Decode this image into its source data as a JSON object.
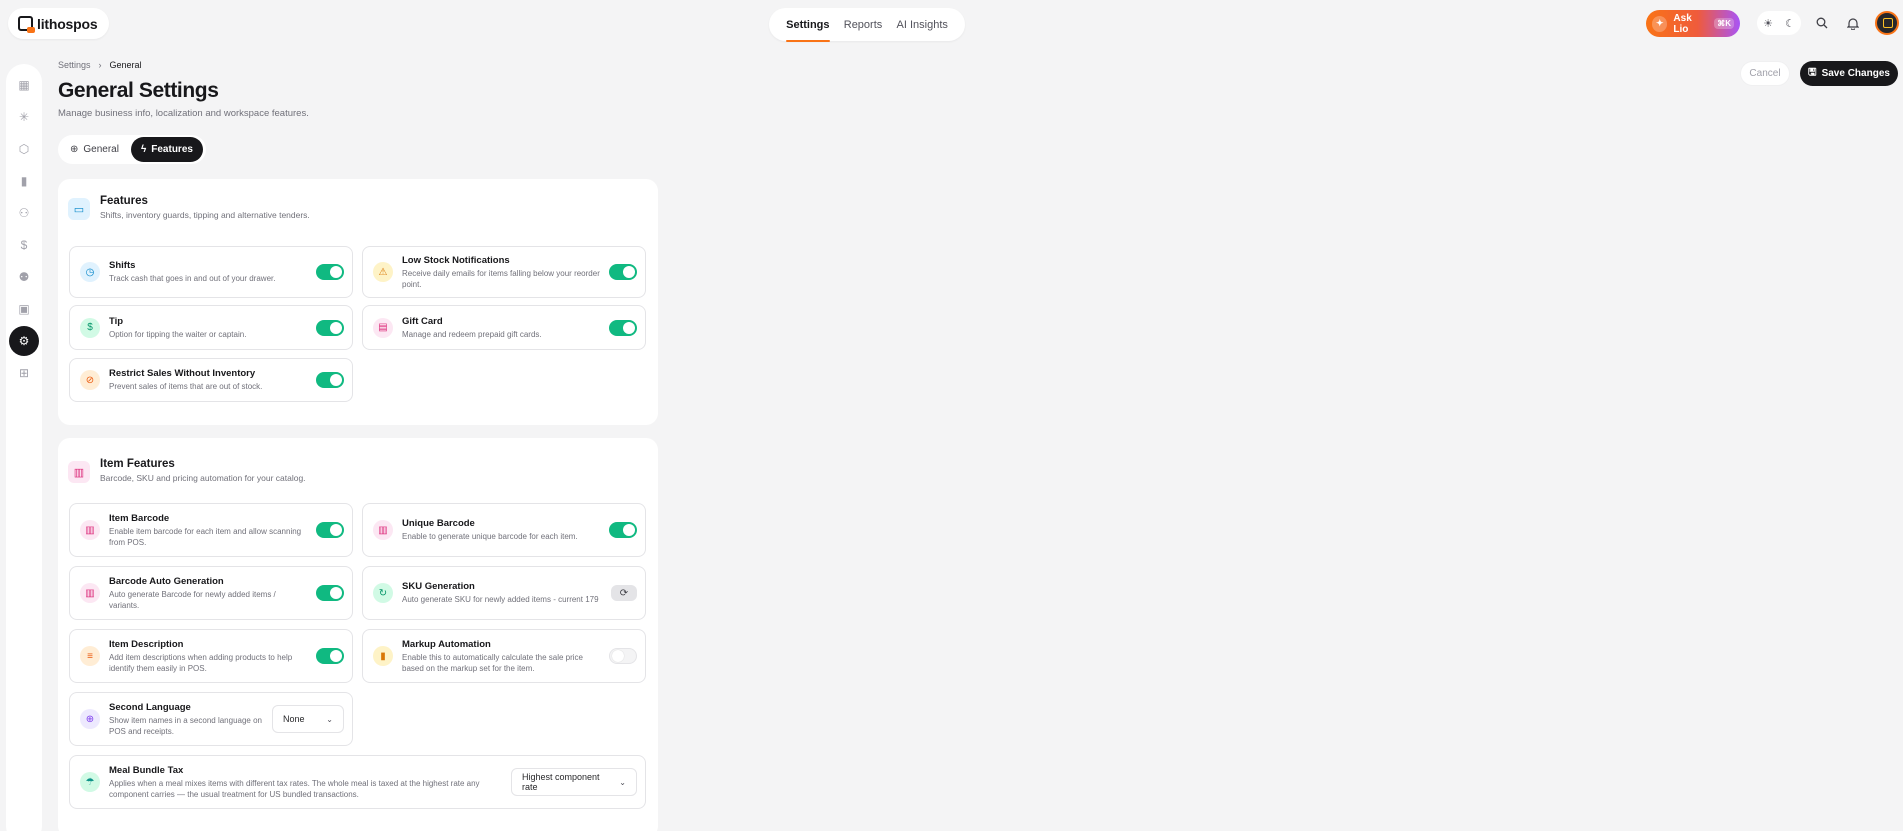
{
  "app": {
    "logo_text": "lithospos"
  },
  "topnav": {
    "items": [
      "Settings",
      "Reports",
      "AI Insights"
    ],
    "active_index": 0
  },
  "ask_lio": {
    "label": "Ask Lio",
    "shortcut": "⌘K"
  },
  "breadcrumb": {
    "parent": "Settings",
    "current": "General"
  },
  "page": {
    "title": "General Settings",
    "subtitle": "Manage business info, localization and workspace features."
  },
  "actions": {
    "cancel": "Cancel",
    "save": "Save Changes"
  },
  "tabs": [
    {
      "label": "General",
      "active": false
    },
    {
      "label": "Features",
      "active": true
    }
  ],
  "features_card": {
    "title": "Features",
    "subtitle": "Shifts, inventory guards, tipping and alternative tenders.",
    "items": [
      {
        "title": "Shifts",
        "desc": "Track cash that goes in and out of your drawer.",
        "enabled": true
      },
      {
        "title": "Low Stock Notifications",
        "desc": "Receive daily emails for items falling below your reorder point.",
        "enabled": true
      },
      {
        "title": "Tip",
        "desc": "Option for tipping the waiter or captain.",
        "enabled": true
      },
      {
        "title": "Gift Card",
        "desc": "Manage and redeem prepaid gift cards.",
        "enabled": true
      },
      {
        "title": "Restrict Sales Without Inventory",
        "desc": "Prevent sales of items that are out of stock.",
        "enabled": true
      }
    ]
  },
  "item_features_card": {
    "title": "Item Features",
    "subtitle": "Barcode, SKU and pricing automation for your catalog.",
    "items": [
      {
        "title": "Item Barcode",
        "desc": "Enable item barcode for each item and allow scanning from POS.",
        "enabled": true
      },
      {
        "title": "Unique Barcode",
        "desc": "Enable to generate unique barcode for each item.",
        "enabled": true
      },
      {
        "title": "Barcode Auto Generation",
        "desc": "Auto generate Barcode for newly added items / variants.",
        "enabled": true
      },
      {
        "title": "SKU Generation",
        "desc": "Auto generate SKU for newly added items - current 179"
      },
      {
        "title": "Item Description",
        "desc": "Add item descriptions when adding products to help identify them easily in POS.",
        "enabled": true
      },
      {
        "title": "Markup Automation",
        "desc": "Enable this to automatically calculate the sale price based on the markup set for the item.",
        "enabled": false
      },
      {
        "title": "Second Language",
        "desc": "Show item names in a second language on POS and receipts.",
        "select_value": "None"
      },
      {
        "title": "Meal Bundle Tax",
        "desc": "Applies when a meal mixes items with different tax rates. The whole meal is taxed at the highest rate any component carries — the usual treatment for US bundled transactions.",
        "select_value": "Highest component rate"
      }
    ]
  }
}
